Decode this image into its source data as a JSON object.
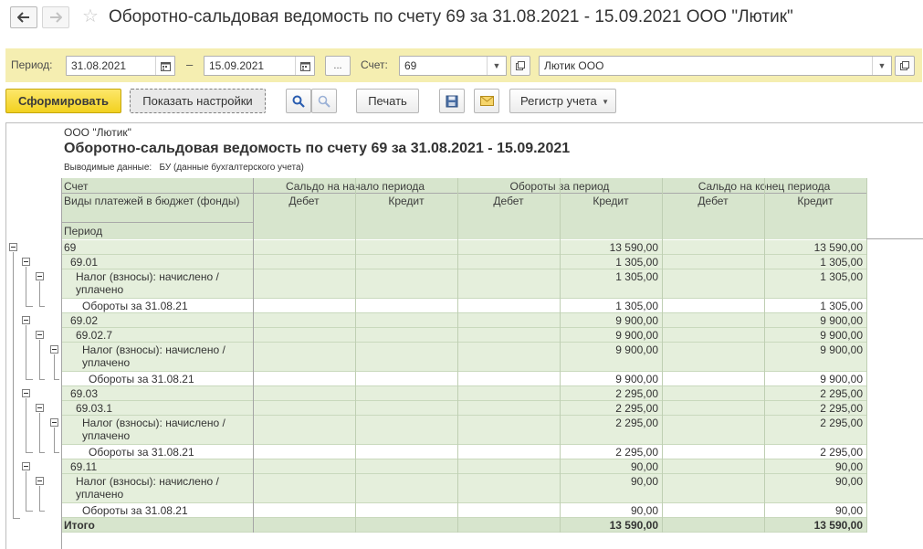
{
  "window": {
    "title": "Оборотно-сальдовая ведомость по счету 69 за 31.08.2021 - 15.09.2021 ООО \"Лютик\""
  },
  "params": {
    "period_label": "Период:",
    "date_from": "31.08.2021",
    "date_to": "15.09.2021",
    "period_dash": "–",
    "more_button": "...",
    "account_label": "Счет:",
    "account_value": "69",
    "organization_value": "Лютик ООО"
  },
  "toolbar": {
    "generate": "Сформировать",
    "show_settings": "Показать настройки",
    "print": "Печать",
    "register": "Регистр учета"
  },
  "report": {
    "organization": "ООО \"Лютик\"",
    "title": "Оборотно-сальдовая ведомость по счету 69 за 31.08.2021 - 15.09.2021",
    "output_data_label": "Выводимые данные:",
    "output_data_value": "БУ (данные бухгалтерского учета)",
    "header": {
      "col_account": "Счет",
      "col_budget_types": "Виды платежей в бюджет (фонды)",
      "col_period": "Период",
      "opening_balance": "Сальдо на начало периода",
      "turnover": "Обороты за период",
      "closing_balance": "Сальдо на конец периода",
      "debit": "Дебет",
      "credit": "Кредит"
    },
    "rows": [
      {
        "label": "69",
        "turnover_credit": "13 590,00",
        "closing_credit": "13 590,00"
      },
      {
        "label": "69.01",
        "turnover_credit": "1 305,00",
        "closing_credit": "1 305,00"
      },
      {
        "label": "Налог (взносы): начислено / уплачено",
        "turnover_credit": "1 305,00",
        "closing_credit": "1 305,00"
      },
      {
        "label": "Обороты за 31.08.21",
        "turnover_credit": "1 305,00",
        "closing_credit": "1 305,00"
      },
      {
        "label": "69.02",
        "turnover_credit": "9 900,00",
        "closing_credit": "9 900,00"
      },
      {
        "label": "69.02.7",
        "turnover_credit": "9 900,00",
        "closing_credit": "9 900,00"
      },
      {
        "label": "Налог (взносы): начислено / уплачено",
        "turnover_credit": "9 900,00",
        "closing_credit": "9 900,00"
      },
      {
        "label": "Обороты за 31.08.21",
        "turnover_credit": "9 900,00",
        "closing_credit": "9 900,00"
      },
      {
        "label": "69.03",
        "turnover_credit": "2 295,00",
        "closing_credit": "2 295,00"
      },
      {
        "label": "69.03.1",
        "turnover_credit": "2 295,00",
        "closing_credit": "2 295,00"
      },
      {
        "label": "Налог (взносы): начислено / уплачено",
        "turnover_credit": "2 295,00",
        "closing_credit": "2 295,00"
      },
      {
        "label": "Обороты за 31.08.21",
        "turnover_credit": "2 295,00",
        "closing_credit": "2 295,00"
      },
      {
        "label": "69.11",
        "turnover_credit": "90,00",
        "closing_credit": "90,00"
      },
      {
        "label": "Налог (взносы): начислено / уплачено",
        "turnover_credit": "90,00",
        "closing_credit": "90,00"
      },
      {
        "label": "Обороты за 31.08.21",
        "turnover_credit": "90,00",
        "closing_credit": "90,00"
      }
    ],
    "total": {
      "label": "Итого",
      "turnover_credit": "13 590,00",
      "closing_credit": "13 590,00"
    }
  },
  "colors": {
    "params_bar": "#f5eeb1",
    "header_green": "#d7e5cd",
    "group_green": "#e5efdc",
    "total_green": "#d7e5cd",
    "primary_button": "#f2d11f"
  }
}
